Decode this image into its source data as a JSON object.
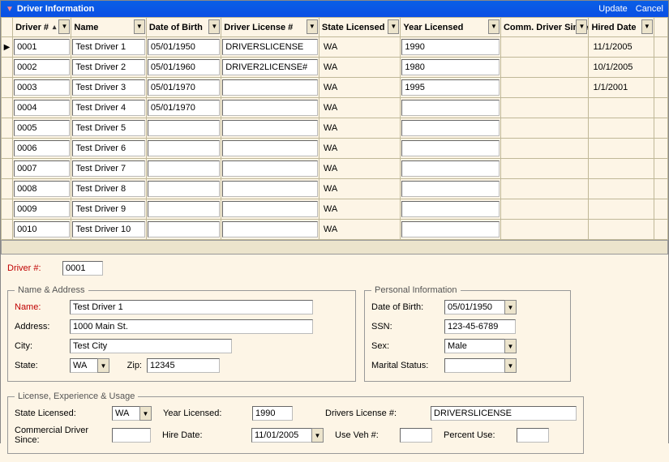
{
  "titlebar": {
    "title": "Driver Information",
    "update": "Update",
    "cancel": "Cancel"
  },
  "grid": {
    "headers": {
      "driver_no": "Driver #",
      "name": "Name",
      "dob": "Date of Birth",
      "license": "Driver License #",
      "state": "State Licensed",
      "year": "Year Licensed",
      "comm": "Comm. Driver Since",
      "hired": "Hired Date"
    },
    "rows": [
      {
        "sel": true,
        "driver_no": "0001",
        "name": "Test Driver 1",
        "dob": "05/01/1950",
        "license": "DRIVERSLICENSE",
        "state": "WA",
        "year": "1990",
        "comm": "",
        "hired": "11/1/2005"
      },
      {
        "sel": false,
        "driver_no": "0002",
        "name": "Test Driver 2",
        "dob": "05/01/1960",
        "license": "DRIVER2LICENSE#",
        "state": "WA",
        "year": "1980",
        "comm": "",
        "hired": "10/1/2005"
      },
      {
        "sel": false,
        "driver_no": "0003",
        "name": "Test Driver 3",
        "dob": "05/01/1970",
        "license": "",
        "state": "WA",
        "year": "1995",
        "comm": "",
        "hired": "1/1/2001"
      },
      {
        "sel": false,
        "driver_no": "0004",
        "name": "Test Driver 4",
        "dob": "05/01/1970",
        "license": "",
        "state": "WA",
        "year": "",
        "comm": "",
        "hired": ""
      },
      {
        "sel": false,
        "driver_no": "0005",
        "name": "Test Driver 5",
        "dob": "",
        "license": "",
        "state": "WA",
        "year": "",
        "comm": "",
        "hired": ""
      },
      {
        "sel": false,
        "driver_no": "0006",
        "name": "Test Driver 6",
        "dob": "",
        "license": "",
        "state": "WA",
        "year": "",
        "comm": "",
        "hired": ""
      },
      {
        "sel": false,
        "driver_no": "0007",
        "name": "Test Driver 7",
        "dob": "",
        "license": "",
        "state": "WA",
        "year": "",
        "comm": "",
        "hired": ""
      },
      {
        "sel": false,
        "driver_no": "0008",
        "name": "Test Driver 8",
        "dob": "",
        "license": "",
        "state": "WA",
        "year": "",
        "comm": "",
        "hired": ""
      },
      {
        "sel": false,
        "driver_no": "0009",
        "name": "Test Driver 9",
        "dob": "",
        "license": "",
        "state": "WA",
        "year": "",
        "comm": "",
        "hired": ""
      },
      {
        "sel": false,
        "driver_no": "0010",
        "name": "Test Driver 10",
        "dob": "",
        "license": "",
        "state": "WA",
        "year": "",
        "comm": "",
        "hired": ""
      }
    ]
  },
  "detail": {
    "driver_no_label": "Driver #:",
    "driver_no": "0001",
    "name_address_legend": "Name & Address",
    "name_label": "Name:",
    "name": "Test Driver 1",
    "address_label": "Address:",
    "address": "1000 Main St.",
    "city_label": "City:",
    "city": "Test City",
    "state_label": "State:",
    "state": "WA",
    "zip_label": "Zip:",
    "zip": "12345",
    "personal_legend": "Personal Information",
    "dob_label": "Date of Birth:",
    "dob": "05/01/1950",
    "ssn_label": "SSN:",
    "ssn": "123-45-6789",
    "sex_label": "Sex:",
    "sex": "Male",
    "marital_label": "Marital Status:",
    "marital": "",
    "license_legend": "License, Experience & Usage",
    "state_lic_label": "State Licensed:",
    "state_lic": "WA",
    "year_lic_label": "Year Licensed:",
    "year_lic": "1990",
    "dln_label": "Drivers License #:",
    "dln": "DRIVERSLICENSE",
    "comm_since_label": "Commercial Driver Since:",
    "comm_since": "",
    "hire_label": "Hire Date:",
    "hire": "11/01/2005",
    "use_veh_label": "Use Veh #:",
    "use_veh": "",
    "pct_use_label": "Percent Use:",
    "pct_use": ""
  }
}
